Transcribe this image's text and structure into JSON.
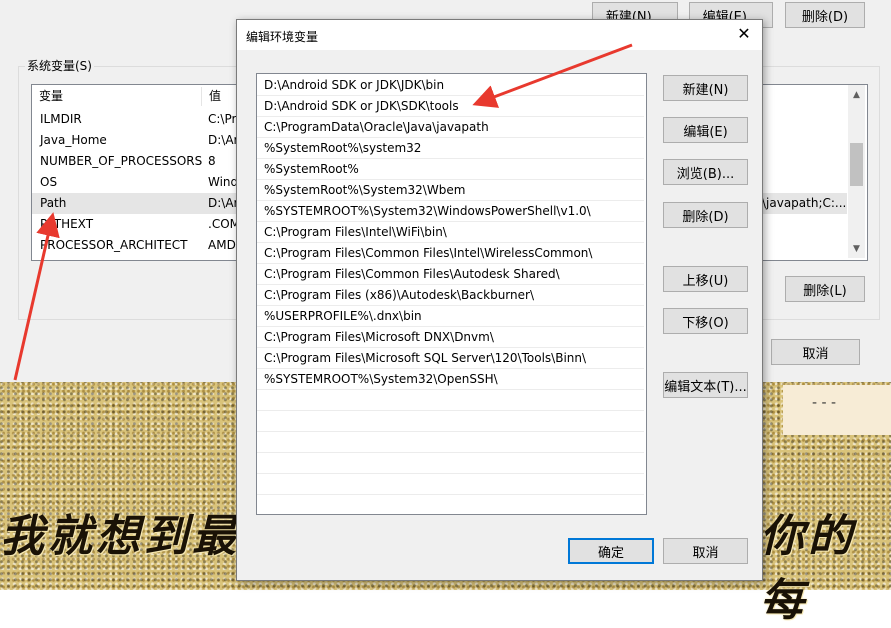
{
  "parent": {
    "top_buttons": {
      "new": "新建(N)...",
      "edit": "编辑(E)...",
      "delete": "删除(D)"
    },
    "sysvars_label": "系统变量(S)",
    "columns": {
      "variable": "变量",
      "value": "值"
    },
    "rows": [
      {
        "name": "ILMDIR",
        "value": "C:\\Pr"
      },
      {
        "name": "Java_Home",
        "value": "D:\\Ar"
      },
      {
        "name": "NUMBER_OF_PROCESSORS",
        "value": "8"
      },
      {
        "name": "OS",
        "value": "Wind"
      },
      {
        "name": "Path",
        "value": "D:\\Ar",
        "value_right": "\\javapath;C:..."
      },
      {
        "name": "PATHEXT",
        "value": ".COM"
      },
      {
        "name": "PROCESSOR_ARCHITECT",
        "value": "AMD"
      }
    ],
    "bottom_delete": "删除(L)",
    "cancel": "取消"
  },
  "dialog": {
    "title": "编辑环境变量",
    "close_glyph": "✕",
    "paths": [
      "D:\\Android SDK or JDK\\JDK\\bin",
      "D:\\Android SDK or JDK\\SDK\\tools",
      "C:\\ProgramData\\Oracle\\Java\\javapath",
      "%SystemRoot%\\system32",
      "%SystemRoot%",
      "%SystemRoot%\\System32\\Wbem",
      "%SYSTEMROOT%\\System32\\WindowsPowerShell\\v1.0\\",
      "C:\\Program Files\\Intel\\WiFi\\bin\\",
      "C:\\Program Files\\Common Files\\Intel\\WirelessCommon\\",
      "C:\\Program Files\\Common Files\\Autodesk Shared\\",
      "C:\\Program Files (x86)\\Autodesk\\Backburner\\",
      "%USERPROFILE%\\.dnx\\bin",
      "C:\\Program Files\\Microsoft DNX\\Dnvm\\",
      "C:\\Program Files\\Microsoft SQL Server\\120\\Tools\\Binn\\",
      "%SYSTEMROOT%\\System32\\OpenSSH\\"
    ],
    "buttons": {
      "new": "新建(N)",
      "edit": "编辑(E)",
      "browse": "浏览(B)...",
      "delete": "删除(D)",
      "move_up": "上移(U)",
      "move_down": "下移(O)",
      "edit_text": "编辑文本(T)...",
      "ok": "确定",
      "cancel": "取消"
    }
  },
  "desktop": {
    "banner_left": "我就想到最",
    "banner_right": "你的每",
    "dashes": "- - -"
  },
  "colors": {
    "annotation_arrow": "#e8392e",
    "focus_border": "#0078d7"
  }
}
